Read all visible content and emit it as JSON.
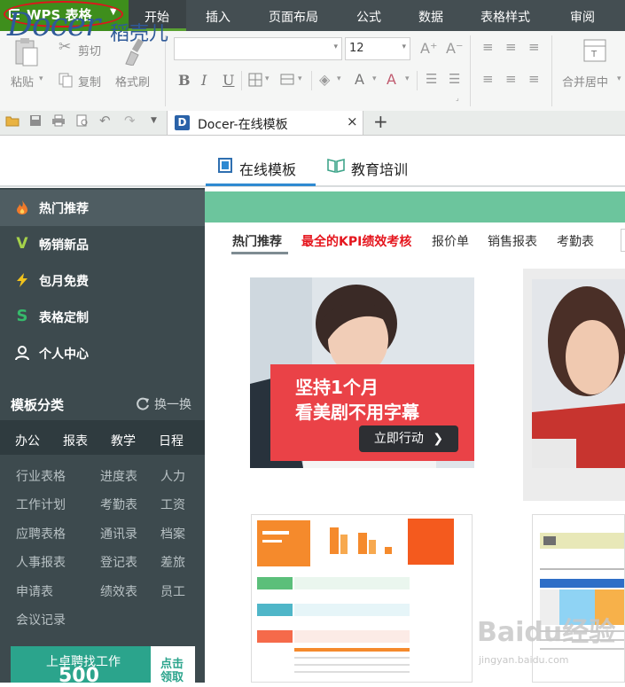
{
  "app": {
    "name": "WPS 表格",
    "menu": [
      "开始",
      "插入",
      "页面布局",
      "公式",
      "数据",
      "表格样式",
      "审阅"
    ],
    "active_menu": "开始"
  },
  "ribbon": {
    "cut": "剪切",
    "paste": "粘贴",
    "copy": "复制",
    "format_painter": "格式刷",
    "font_name": "",
    "font_size": "12",
    "grow_font": "A⁺",
    "shrink_font": "A⁻",
    "bold": "B",
    "italic": "I",
    "underline": "U",
    "merge_center": "合并居中"
  },
  "tabs": {
    "doc_title": "Docer-在线模板",
    "close": "×",
    "add": "+"
  },
  "docer": {
    "logo": "Docer",
    "logo_cn": "稻壳儿",
    "nav": [
      {
        "label": "在线模板",
        "active": true
      },
      {
        "label": "教育培训",
        "active": false
      }
    ]
  },
  "sidebar": {
    "items": [
      {
        "label": "热门推荐",
        "icon": "flame-icon"
      },
      {
        "label": "畅销新品",
        "icon": "v-icon"
      },
      {
        "label": "包月免费",
        "icon": "lightning-icon"
      },
      {
        "label": "表格定制",
        "icon": "s-icon"
      },
      {
        "label": "个人中心",
        "icon": "user-icon"
      }
    ],
    "category_title": "模板分类",
    "swap_label": "换一换",
    "category_tabs": [
      "办公",
      "报表",
      "教学",
      "日程"
    ],
    "category_links": [
      [
        "行业表格",
        "进度表",
        "人力"
      ],
      [
        "工作计划",
        "考勤表",
        "工资"
      ],
      [
        "应聘表格",
        "通讯录",
        "档案"
      ],
      [
        "人事报表",
        "登记表",
        "差旅"
      ],
      [
        "申请表",
        "绩效表",
        "员工"
      ],
      [
        "会议记录",
        "",
        ""
      ]
    ],
    "recruit_text": "上卓聘找工作",
    "recruit_num": "500",
    "recruit_btn_l1": "点击",
    "recruit_btn_l2": "领取"
  },
  "main": {
    "hot_tabs": [
      "热门推荐",
      "最全的KPI绩效考核",
      "报价单",
      "销售报表",
      "考勤表"
    ],
    "promo_line1": "坚持1个月",
    "promo_line2": "看美剧不用字幕",
    "promo_button": "立即行动",
    "promo_arrow": "❯"
  },
  "watermark": {
    "text": "Baidu经验",
    "sub": "jingyan.baidu.com"
  },
  "colors": {
    "accent_green": "#5aa132",
    "docer_blue": "#2f5a99",
    "sidebar_bg": "#3d4a4e",
    "promo_red": "#ea4247",
    "kpi_red": "#e5161e"
  }
}
